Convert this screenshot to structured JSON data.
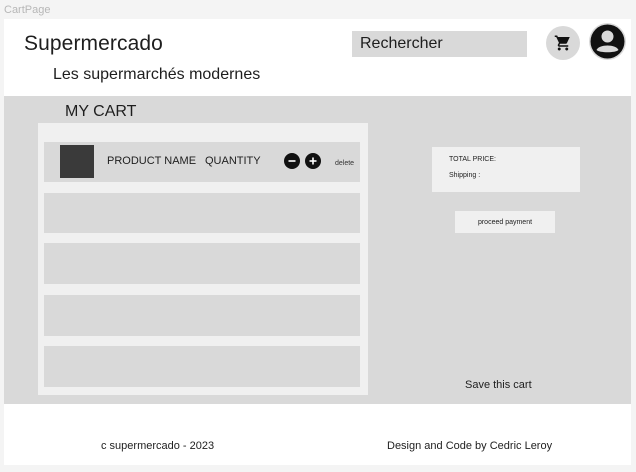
{
  "frame_label": "CartPage",
  "header": {
    "brand": "Supermercado",
    "tagline": "Les supermarchés modernes",
    "search_text": "Rechercher",
    "cart_icon": "shopping-cart-icon",
    "user_icon": "user-account-icon"
  },
  "cart": {
    "heading": "MY CART",
    "item": {
      "product_name": "PRODUCT NAME",
      "quantity_label": "QUANTITY",
      "delete_label": "delete",
      "decrease_icon": "minus-icon",
      "increase_icon": "plus-icon"
    },
    "empty_row_count": 4
  },
  "summary": {
    "total_label": "TOTAL PRICE:",
    "shipping_label": "Shipping :",
    "payment_button": "proceed payment",
    "save_cart": "Save this cart"
  },
  "footer": {
    "copyright": "c supermercado - 2023",
    "credit": "Design and Code by Cedric Leroy"
  },
  "colors": {
    "placeholder_gray": "#d9d9d9",
    "panel_light": "#f0f0f0",
    "thumbnail": "#3a3a3a",
    "text": "#1e1e1e"
  }
}
